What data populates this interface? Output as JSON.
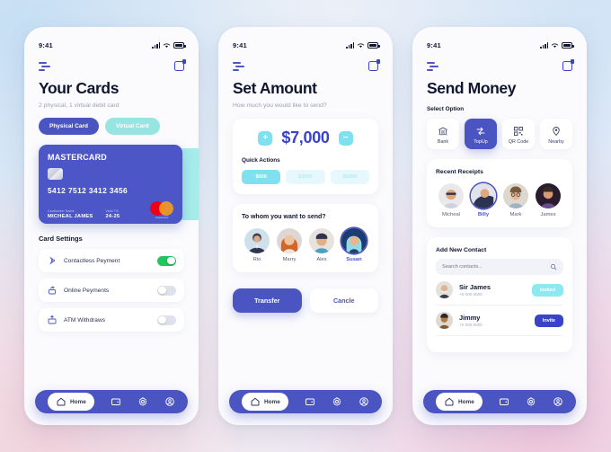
{
  "background": {
    "accent": "#4b55c2",
    "teal": "#8fe8ef",
    "green": "#22c55e"
  },
  "status_bar": {
    "time": "9:41"
  },
  "screen1": {
    "title": "Your Cards",
    "subtitle": "2 physical, 1 virtual debit card",
    "tabs": [
      {
        "label": "Physical Card",
        "selected": true
      },
      {
        "label": "Virtual Card",
        "selected": false
      }
    ],
    "card": {
      "brand": "MASTERCARD",
      "number": "5412 7512 3412 3456",
      "holder_label": "Cardholder Name",
      "holder_name": "MICHEAL JAMES",
      "valid_label": "Valid Till",
      "valid_value": "24-25",
      "network_text": "mastercard"
    },
    "settings_title": "Card Settings",
    "settings": [
      {
        "label": "Contactless Peyment",
        "icon": "contactless-icon",
        "on": true
      },
      {
        "label": "Online Peyments",
        "icon": "online-payment-icon",
        "on": false
      },
      {
        "label": "ATM Withdraws",
        "icon": "atm-icon",
        "on": false
      }
    ]
  },
  "screen2": {
    "title": "Set Amount",
    "subtitle": "How much you would like to send?",
    "amount": "$7,000",
    "plus_label": "+",
    "minus_label": "−",
    "quick_actions_title": "Quick Actions",
    "quick_amounts": [
      {
        "label": "$500",
        "selected": true
      },
      {
        "label": "$1500",
        "selected": false
      },
      {
        "label": "$2000",
        "selected": false
      }
    ],
    "recipients_title": "To whom you want to send?",
    "recipients": [
      {
        "name": "Rio",
        "selected": false
      },
      {
        "name": "Marry",
        "selected": false
      },
      {
        "name": "Alex",
        "selected": false
      },
      {
        "name": "Susan",
        "selected": true
      }
    ],
    "transfer_label": "Transfer",
    "cancel_label": "Cancle"
  },
  "screen3": {
    "title": "Send Money",
    "select_option_label": "Select Option",
    "options": [
      {
        "label": "Bank",
        "icon": "bank-icon",
        "selected": false
      },
      {
        "label": "TopUp",
        "icon": "topup-icon",
        "selected": true
      },
      {
        "label": "QR Code",
        "icon": "qr-code-icon",
        "selected": false
      },
      {
        "label": "Nearby",
        "icon": "location-pin-icon",
        "selected": false
      }
    ],
    "recent_receipts_title": "Recent Receipts",
    "recent_receipts": [
      {
        "name": "Micheal",
        "selected": false
      },
      {
        "name": "Billy",
        "selected": true
      },
      {
        "name": "Mark",
        "selected": false
      },
      {
        "name": "James",
        "selected": false
      }
    ],
    "add_contact_title": "Add New Contact",
    "search_placeholder": "Search contacts...",
    "contacts": [
      {
        "name": "Sir James",
        "phone": "+0 000 0000",
        "action": "Invited",
        "state": "invited"
      },
      {
        "name": "Jimmy",
        "phone": "+0 000 0000",
        "action": "Invite",
        "state": "invite"
      }
    ]
  },
  "bottom_nav": {
    "home_label": "Home",
    "items": [
      "home-icon",
      "wallet-icon",
      "gear-icon",
      "profile-icon"
    ]
  }
}
